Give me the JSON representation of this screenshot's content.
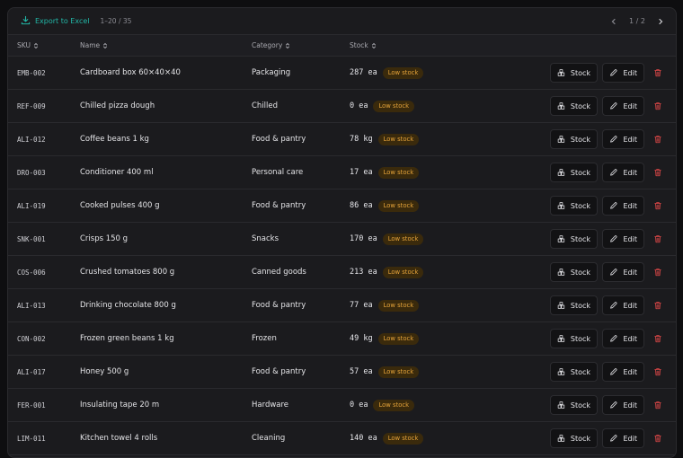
{
  "toolbar": {
    "export_label": "Export to Excel",
    "range": "1–20 / 35",
    "page": "1 / 2"
  },
  "columns": {
    "sku": "SKU",
    "name": "Name",
    "category": "Category",
    "stock": "Stock"
  },
  "actions": {
    "stock_label": "Stock",
    "edit_label": "Edit"
  },
  "colors": {
    "accent": "#22b8a8",
    "badge_text": "#e6a43a",
    "delete": "#e04848"
  },
  "rows": [
    {
      "sku": "EMB-002",
      "name": "Cardboard box 60×40×40",
      "category": "Packaging",
      "qty": "287 ea",
      "badge": "Low stock"
    },
    {
      "sku": "REF-009",
      "name": "Chilled pizza dough",
      "category": "Chilled",
      "qty": "0 ea",
      "badge": "Low stock"
    },
    {
      "sku": "ALI-012",
      "name": "Coffee beans 1 kg",
      "category": "Food & pantry",
      "qty": "78 kg",
      "badge": "Low stock"
    },
    {
      "sku": "DRO-003",
      "name": "Conditioner 400 ml",
      "category": "Personal care",
      "qty": "17 ea",
      "badge": "Low stock"
    },
    {
      "sku": "ALI-019",
      "name": "Cooked pulses 400 g",
      "category": "Food & pantry",
      "qty": "86 ea",
      "badge": "Low stock"
    },
    {
      "sku": "SNK-001",
      "name": "Crisps 150 g",
      "category": "Snacks",
      "qty": "170 ea",
      "badge": "Low stock"
    },
    {
      "sku": "COS-006",
      "name": "Crushed tomatoes 800 g",
      "category": "Canned goods",
      "qty": "213 ea",
      "badge": "Low stock"
    },
    {
      "sku": "ALI-013",
      "name": "Drinking chocolate 800 g",
      "category": "Food & pantry",
      "qty": "77 ea",
      "badge": "Low stock"
    },
    {
      "sku": "CON-002",
      "name": "Frozen green beans 1 kg",
      "category": "Frozen",
      "qty": "49 kg",
      "badge": "Low stock"
    },
    {
      "sku": "ALI-017",
      "name": "Honey 500 g",
      "category": "Food & pantry",
      "qty": "57 ea",
      "badge": "Low stock"
    },
    {
      "sku": "FER-001",
      "name": "Insulating tape 20 m",
      "category": "Hardware",
      "qty": "0 ea",
      "badge": "Low stock"
    },
    {
      "sku": "LIM-011",
      "name": "Kitchen towel 4 rolls",
      "category": "Cleaning",
      "qty": "140 ea",
      "badge": "Low stock"
    }
  ]
}
